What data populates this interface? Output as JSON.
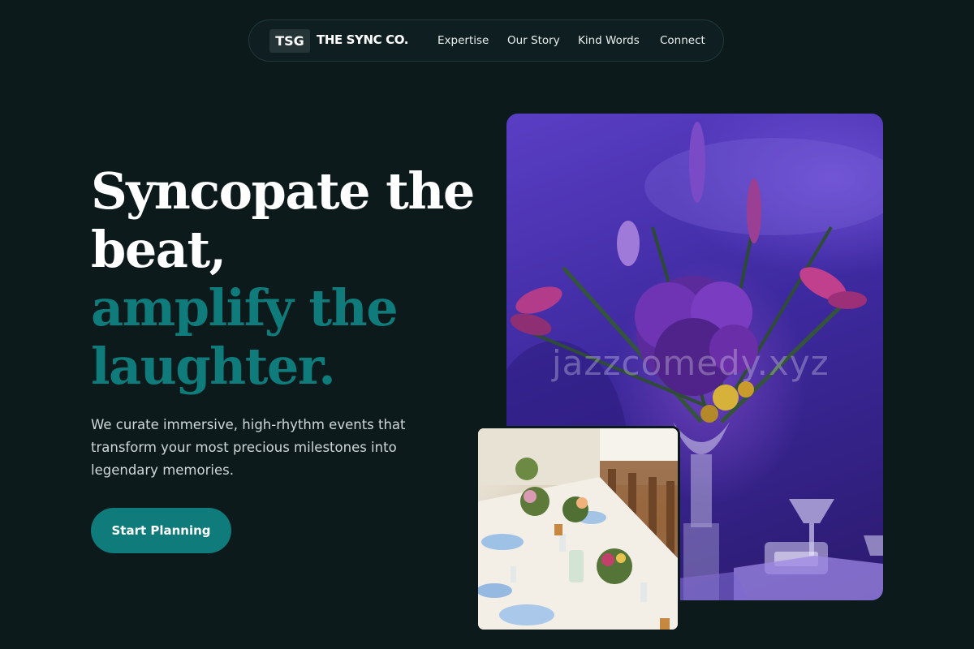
{
  "nav": {
    "logo_badge": "TSG",
    "brand_name": "THE SYNC CO.",
    "links": [
      "Expertise",
      "Our Story",
      "Kind Words",
      "Connect"
    ]
  },
  "hero": {
    "title_line1": "Syncopate the",
    "title_line2": "beat,",
    "title_accent_line1": "amplify the",
    "title_accent_line2": "laughter.",
    "subtitle": "We curate immersive, high-rhythm events that transform your most precious milestones into legendary memories.",
    "cta_label": "Start Planning"
  },
  "images": {
    "main_watermark": "jazzcomedy.xyz"
  },
  "colors": {
    "background": "#0c1a1c",
    "accent": "#0f7b7b",
    "nav_border": "#22383a"
  }
}
